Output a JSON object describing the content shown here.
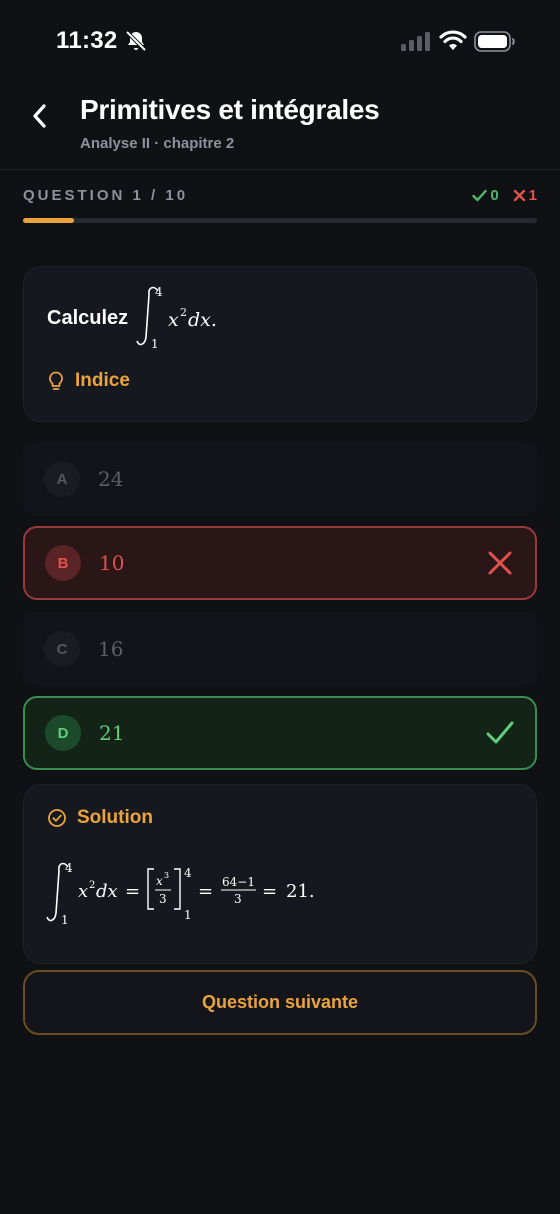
{
  "status_bar": {
    "time": "11:32",
    "icons": [
      "bell-slash-icon",
      "cellular-signal-icon",
      "wifi-icon",
      "battery-icon"
    ]
  },
  "header": {
    "title": "Primitives et intégrales",
    "subtitle": "Analyse II · chapitre 2",
    "back_icon": "chevron-left-icon"
  },
  "progress": {
    "label": "QUESTION 1 / 10",
    "fraction": 0.1,
    "correct_count": "0",
    "wrong_count": "1",
    "correct_color": "#4cb96a",
    "wrong_color": "#e0524c"
  },
  "question": {
    "prompt": "Calculez",
    "formula": {
      "lower": "1",
      "upper": "4",
      "integrand": "x",
      "exponent": "2",
      "differential": "dx."
    },
    "hint_label": "Indice",
    "hint_icon": "lightbulb-icon"
  },
  "options": [
    {
      "letter": "A",
      "value": "24",
      "state": "neutral"
    },
    {
      "letter": "B",
      "value": "10",
      "state": "wrong",
      "mark_icon": "x-mark-icon"
    },
    {
      "letter": "C",
      "value": "16",
      "state": "neutral"
    },
    {
      "letter": "D",
      "value": "21",
      "state": "correct",
      "mark_icon": "checkmark-icon"
    }
  ],
  "solution": {
    "heading": "Solution",
    "icon": "check-circle-icon",
    "formula": {
      "lower": "1",
      "upper": "4",
      "integrand": "x",
      "exponent": "2",
      "differential": "dx",
      "equals": "=",
      "antiderivative_num": "x",
      "antiderivative_exp": "3",
      "antiderivative_den": "3",
      "eval_upper": "4",
      "eval_lower": "1",
      "fraction_num": "64−1",
      "fraction_den": "3",
      "result": "21."
    }
  },
  "next_button": "Question suivante",
  "accent_color": "#eba33e"
}
